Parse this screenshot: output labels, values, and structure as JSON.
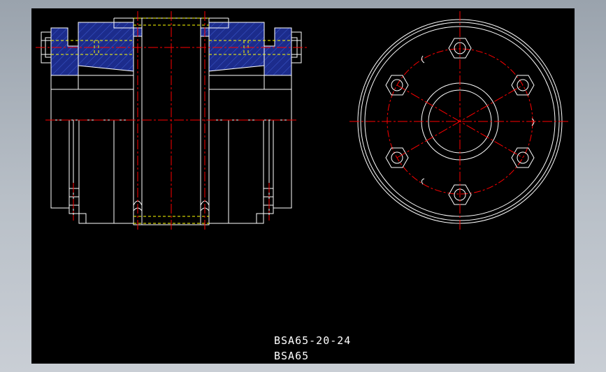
{
  "drawing": {
    "part_number": "BSA65-20-24",
    "model": "BSA65"
  },
  "colors": {
    "background_outer": "#b5bcc4",
    "viewport": "#000000",
    "outline": "#ffffff",
    "centerline": "#ff0000",
    "hidden_line": "#ffff00",
    "hatch": "#1a2a8a"
  },
  "front_view": {
    "bolt_count": 6
  }
}
